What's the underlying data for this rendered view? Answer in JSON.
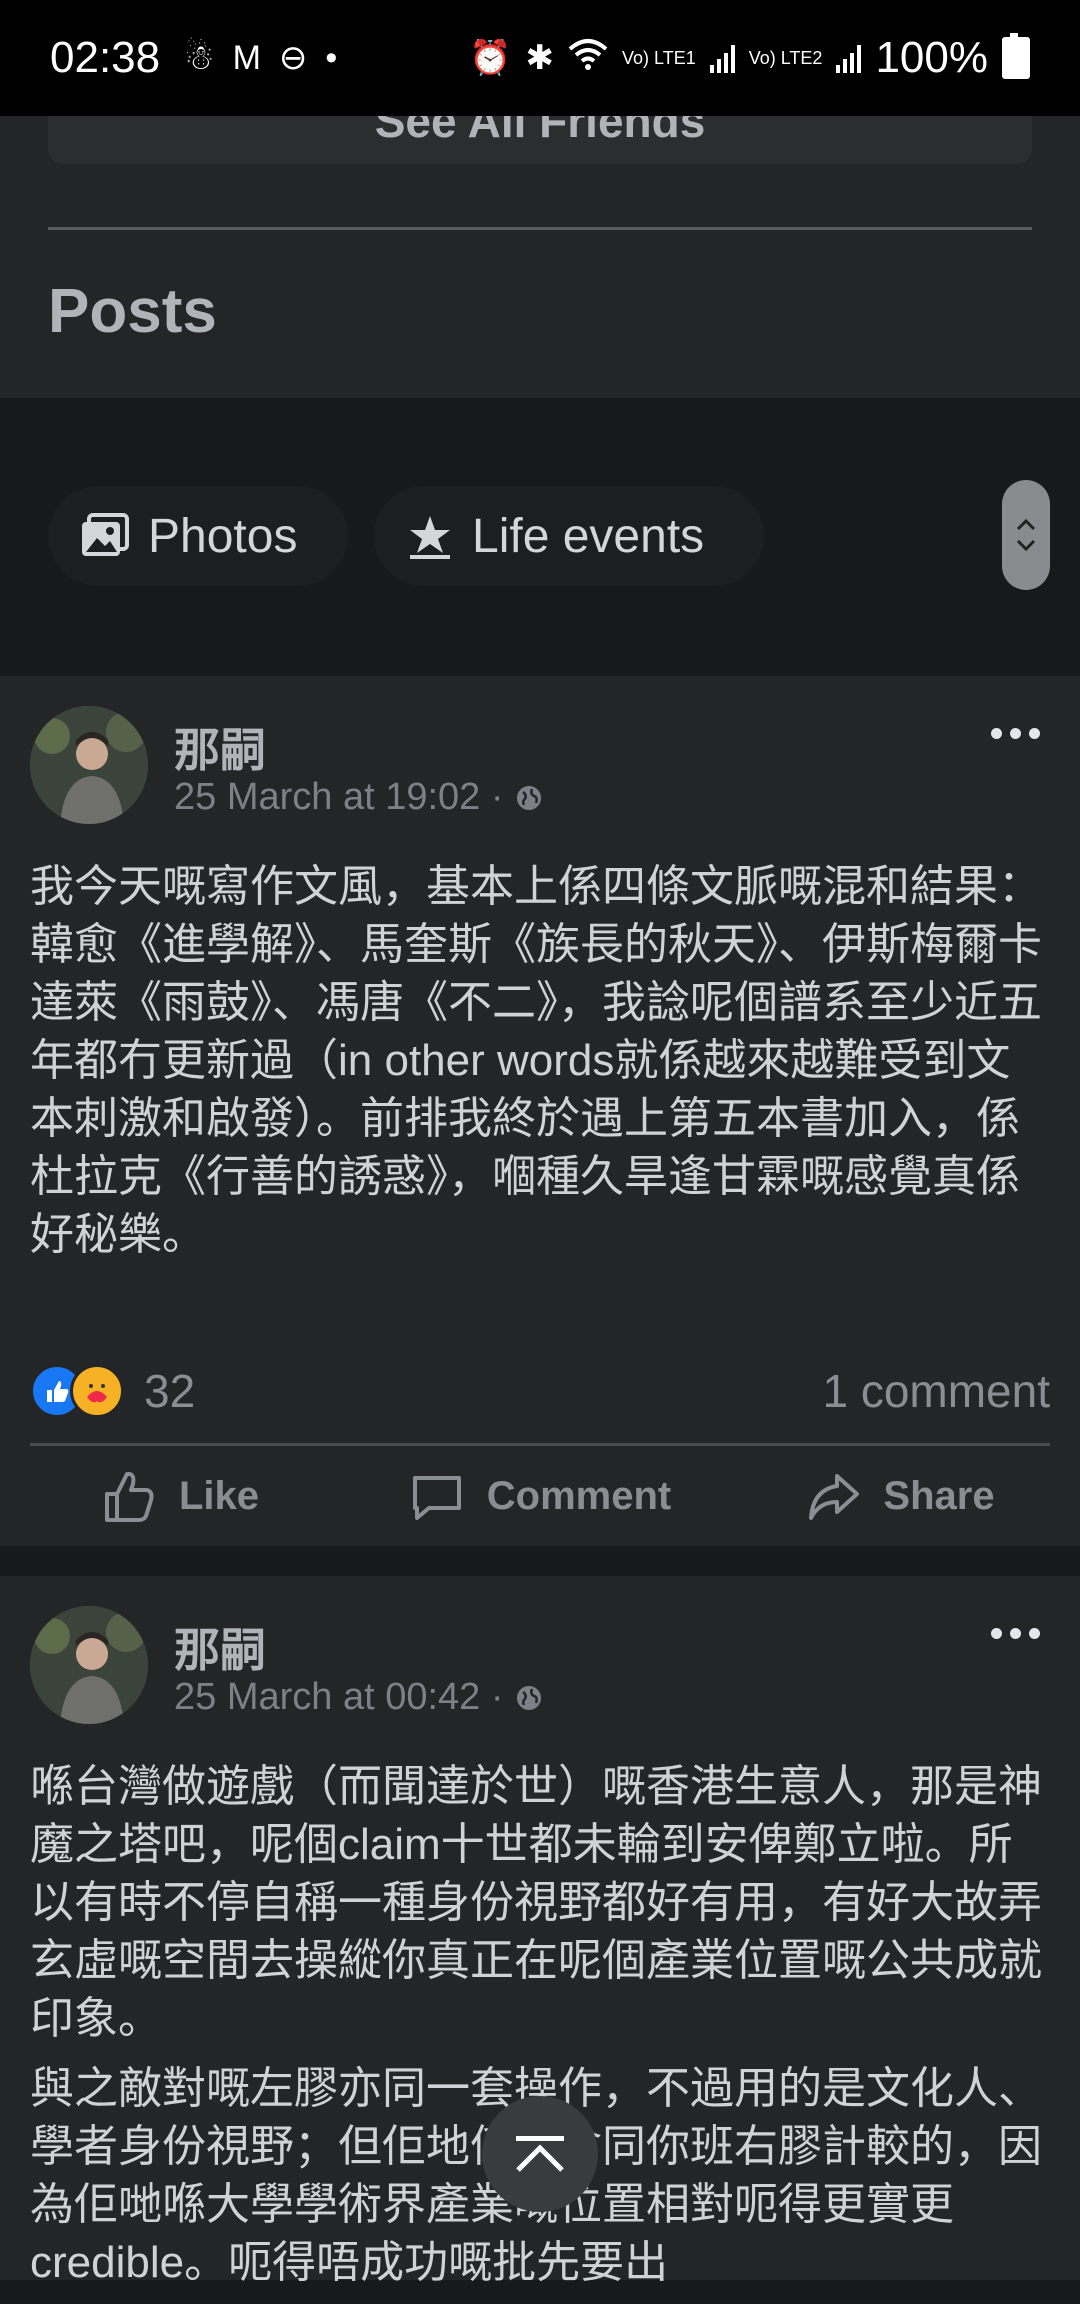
{
  "status_bar": {
    "time": "02:38",
    "lte1": "Vo) LTE1",
    "lte2": "Vo) LTE2",
    "battery": "100%"
  },
  "friends": {
    "see_all_label": "See All Friends"
  },
  "posts_section": {
    "title": "Posts"
  },
  "filters": [
    {
      "label": "Photos",
      "icon": "photos-icon"
    },
    {
      "label": "Life events",
      "icon": "life-events-icon"
    }
  ],
  "posts": [
    {
      "author": "那嗣",
      "timestamp": "25 March at 19:02 ·",
      "privacy_icon": "globe-icon",
      "paragraphs": [
        "我今天嘅寫作文風，基本上係四條文脈嘅混和結果：韓愈《進學解》、馬奎斯《族長的秋天》、伊斯梅爾卡達萊《雨鼓》、馮唐《不二》，我諗呢個譜系至少近五年都冇更新過（in other words就係越來越難受到文本刺激和啟發）。前排我終於遇上第五本書加入，係杜拉克《行善的誘惑》，嗰種久旱逢甘霖嘅感覺真係好秘樂。"
      ],
      "reaction_count": "32",
      "comment_count": "1 comment",
      "actions": {
        "like": "Like",
        "comment": "Comment",
        "share": "Share"
      }
    },
    {
      "author": "那嗣",
      "timestamp": "25 March at 00:42 ·",
      "privacy_icon": "globe-icon",
      "paragraphs": [
        "喺台灣做遊戲（而聞達於世）嘅香港生意人，那是神魔之塔吧，呢個claim十世都未輪到安俾鄭立啦。所以有時不停自稱一種身份視野都好有用，有好大故弄玄虛嘅空間去操縱你真正在呢個產業位置嘅公共成就印象。",
        "與之敵對嘅左膠亦同一套操作，不過用的是文化人、學者身份視野；但佢地係唔會同你班右膠計較的，因為佢哋喺大學學術界產業嘅位置相對呃得更實更credible。呃得唔成功嘅批先要出"
      ]
    }
  ]
}
